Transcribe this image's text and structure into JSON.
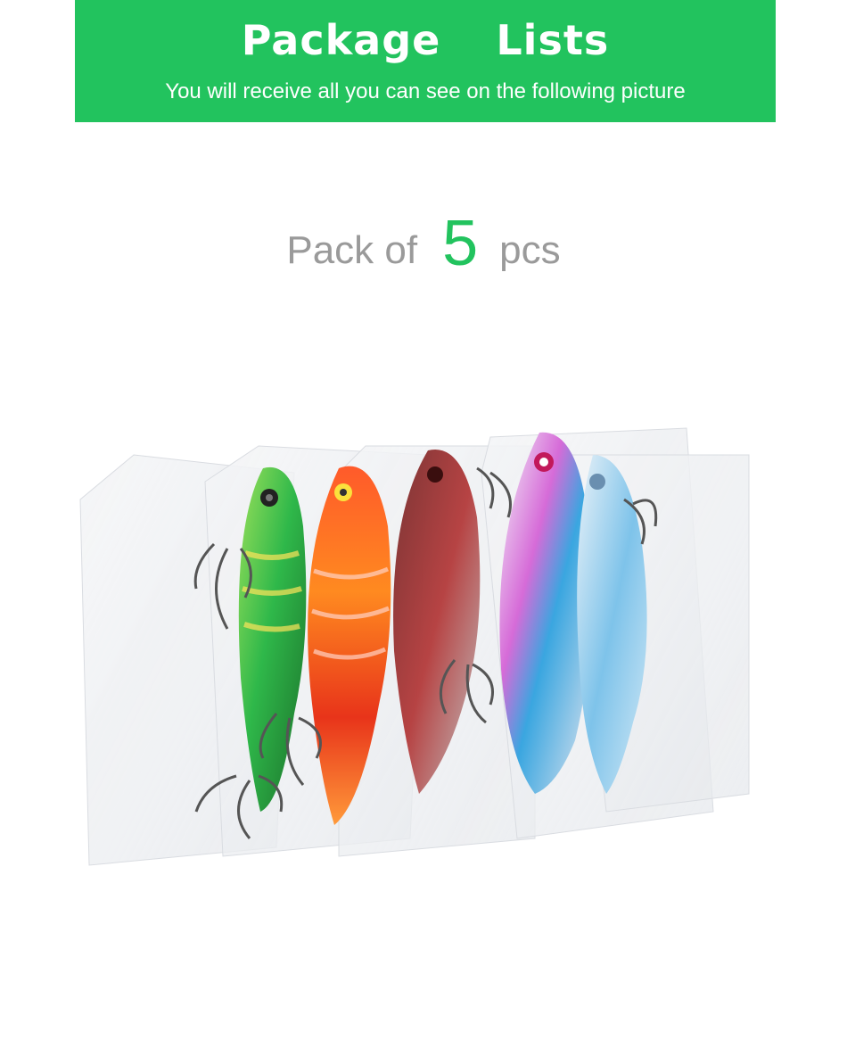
{
  "banner": {
    "title": "Package  Lists",
    "subtitle": "You will receive all you can see on the following picture"
  },
  "pack": {
    "prefix": "Pack of",
    "count": "5",
    "suffix": "pcs"
  },
  "colors": {
    "banner_green": "#22c35e",
    "count_green": "#22c35e",
    "gray_text": "#9a9a9a"
  },
  "product": {
    "lures": [
      {
        "name": "green-lure"
      },
      {
        "name": "orange-red-lure"
      },
      {
        "name": "dark-red-lure"
      },
      {
        "name": "pink-blue-lure"
      },
      {
        "name": "blue-lure"
      }
    ]
  }
}
